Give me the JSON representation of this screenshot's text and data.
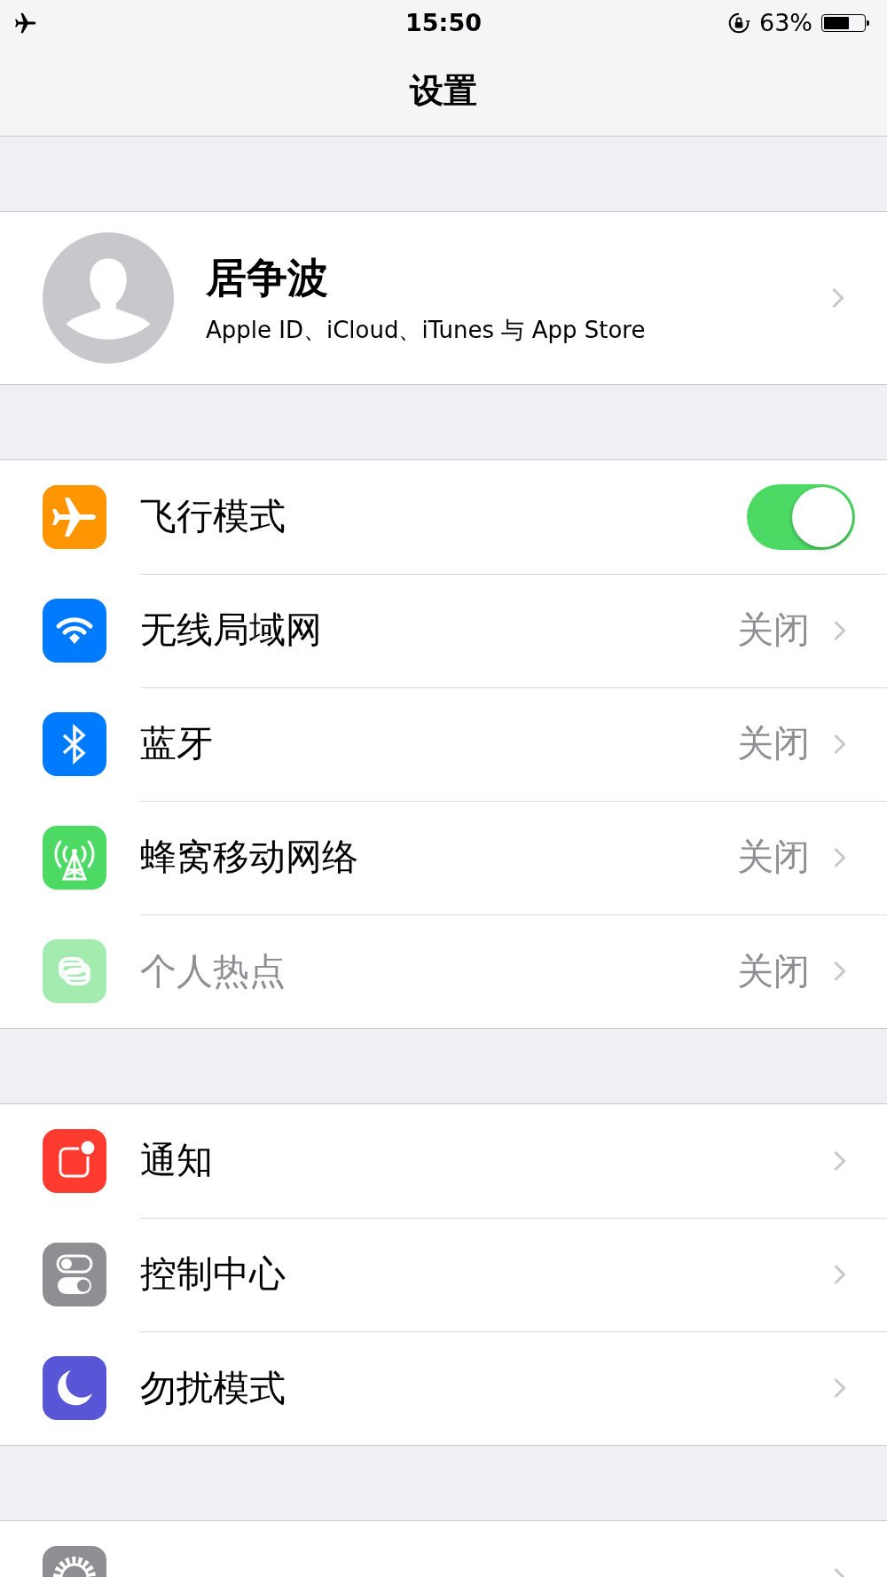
{
  "status_bar": {
    "time": "15:50",
    "battery_percent": "63%",
    "battery": {
      "level": 0.63
    },
    "airplane_mode": true,
    "rotation_lock": true
  },
  "nav_bar": {
    "title": "设置"
  },
  "profile": {
    "name": "居争波",
    "subtitle": "Apple ID、iCloud、iTunes 与 App Store"
  },
  "groups": [
    [
      {
        "label": "飞行模式",
        "kind": "toggle",
        "on": true,
        "disabled": false
      },
      {
        "label": "无线局域网",
        "kind": "link",
        "value": "关闭",
        "disabled": false
      },
      {
        "label": "蓝牙",
        "kind": "link",
        "value": "关闭",
        "disabled": false
      },
      {
        "label": "蜂窝移动网络",
        "kind": "link",
        "value": "关闭",
        "disabled": false
      },
      {
        "label": "个人热点",
        "kind": "link",
        "value": "关闭",
        "disabled": true
      }
    ],
    [
      {
        "label": "通知",
        "kind": "link",
        "disabled": false
      },
      {
        "label": "控制中心",
        "kind": "link",
        "disabled": false
      },
      {
        "label": "勿扰模式",
        "kind": "link",
        "disabled": false
      }
    ],
    [
      {
        "kind": "link",
        "disabled": false
      }
    ]
  ]
}
